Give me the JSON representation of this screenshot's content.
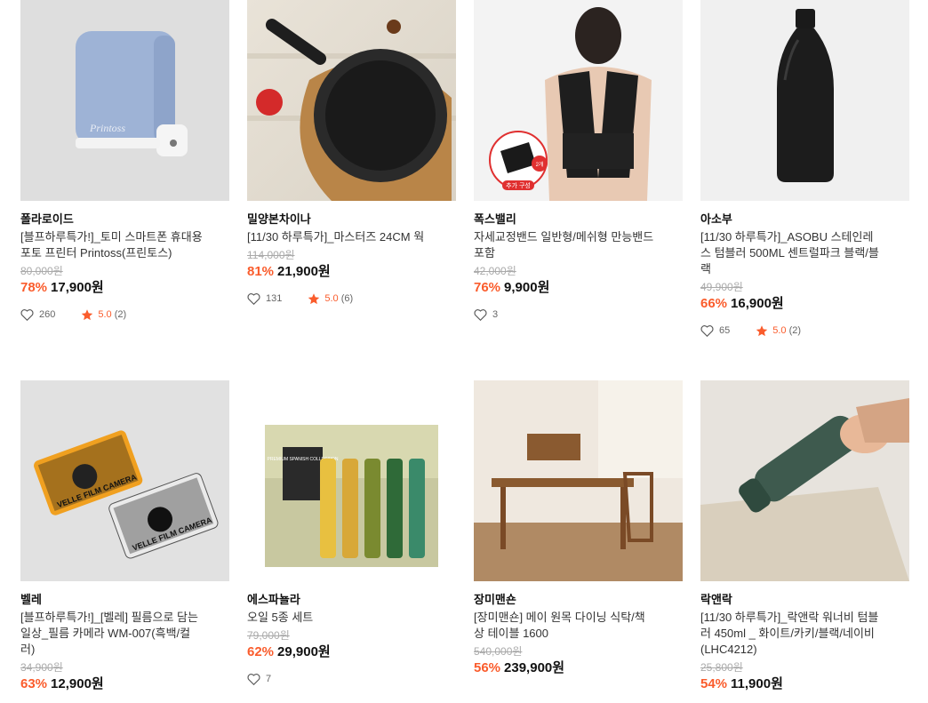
{
  "products": [
    {
      "brand": "폴라로이드",
      "title_lines": [
        "[블프하루특가!]_토미 스마트폰 휴대용",
        "포토 프린터 Printoss(프린토스)"
      ],
      "original_price": "80,000원",
      "discount": "78%",
      "price": "17,900원",
      "likes": "260",
      "rating": "5.0",
      "reviews": "(2)",
      "image_icon": "photo-printer-icon",
      "image_text": "Printoss"
    },
    {
      "brand": "밀양본차이나",
      "title_lines": [
        "[11/30 하루특가]_마스터즈 24CM 웍"
      ],
      "original_price": "114,000원",
      "discount": "81%",
      "price": "21,900원",
      "likes": "131",
      "rating": "5.0",
      "reviews": "(6)",
      "image_icon": "wok-pan-icon"
    },
    {
      "brand": "폭스밸리",
      "title_lines": [
        "자세교정밴드 일반형/메쉬형 만능밴드",
        "포함"
      ],
      "original_price": "42,000원",
      "discount": "76%",
      "price": "9,900원",
      "likes": "3",
      "rating": "",
      "reviews": "",
      "image_icon": "posture-band-icon",
      "image_badge_count": "2개",
      "image_badge_label": "추가 구성"
    },
    {
      "brand": "아소부",
      "title_lines": [
        "[11/30 하루특가]_ASOBU 스테인레",
        "스 텀블러 500ML 센트럴파크 블랙/블",
        "랙"
      ],
      "original_price": "49,900원",
      "discount": "66%",
      "price": "16,900원",
      "likes": "65",
      "rating": "5.0",
      "reviews": "(2)",
      "image_icon": "water-bottle-icon"
    },
    {
      "brand": "벨레",
      "title_lines": [
        "[블프하루특가!]_[벨레] 필름으로 담는",
        "일상_필름 카메라 WM-007(흑백/컬",
        "러)"
      ],
      "original_price": "34,900원",
      "discount": "63%",
      "price": "12,900원",
      "likes": "",
      "rating": "",
      "reviews": "",
      "image_icon": "film-camera-icon",
      "image_text_1": "VELLE FILM CAMERA",
      "image_text_2": "VELLE FILM CAMERA"
    },
    {
      "brand": "에스파뇰라",
      "title_lines": [
        "오일 5종 세트"
      ],
      "original_price": "79,000원",
      "discount": "62%",
      "price": "29,900원",
      "likes": "7",
      "rating": "",
      "reviews": "",
      "image_icon": "oil-bottles-icon",
      "image_box_text": "PREMIUM SPANISH COLLECTION"
    },
    {
      "brand": "장미맨숀",
      "title_lines": [
        "[장미맨숀] 메이 원목 다이닝 식탁/책",
        "상 테이블 1600"
      ],
      "original_price": "540,000원",
      "discount": "56%",
      "price": "239,900원",
      "likes": "",
      "rating": "",
      "reviews": "",
      "image_icon": "wooden-desk-icon"
    },
    {
      "brand": "락앤락",
      "title_lines": [
        "[11/30 하루특가]_락앤락 워너비 텀블",
        "러 450ml _ 화이트/카키/블랙/네이비",
        "(LHC4212)"
      ],
      "original_price": "25,800원",
      "discount": "54%",
      "price": "11,900원",
      "likes": "",
      "rating": "",
      "reviews": "",
      "image_icon": "tumbler-icon"
    }
  ],
  "colors": {
    "discount": "#fa5c2c",
    "star": "#fa5c2c",
    "text": "#222222",
    "muted": "#aaaaaa"
  }
}
